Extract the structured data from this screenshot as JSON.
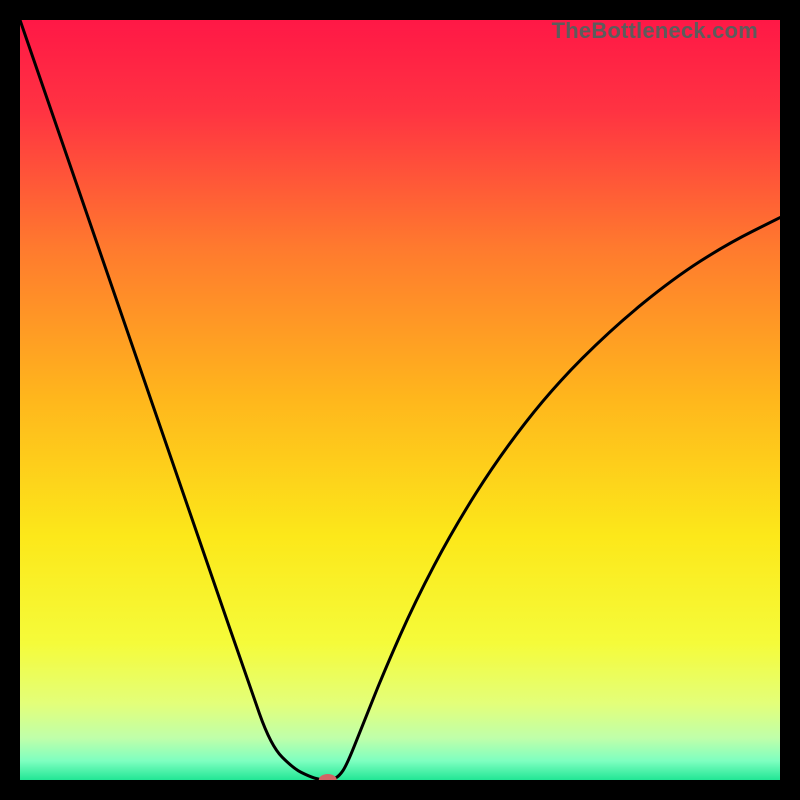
{
  "watermark": "TheBottleneck.com",
  "chart_data": {
    "type": "line",
    "title": "",
    "xlabel": "",
    "ylabel": "",
    "xlim": [
      0,
      100
    ],
    "ylim": [
      0,
      100
    ],
    "grid": false,
    "legend": false,
    "series": [
      {
        "name": "bottleneck-curve",
        "x": [
          0,
          5,
          10,
          15,
          20,
          25,
          30,
          33,
          36,
          38,
          39.5,
          41,
          42,
          43,
          45,
          48,
          52,
          57,
          63,
          70,
          78,
          86,
          93,
          100
        ],
        "y": [
          100,
          85.5,
          71,
          56.5,
          42,
          27.5,
          13,
          4.5,
          1.5,
          0.5,
          0,
          0,
          0.5,
          2,
          7,
          14.5,
          23.5,
          33,
          42.5,
          51.5,
          59.5,
          66,
          70.5,
          74
        ]
      }
    ],
    "marker": {
      "x": 40.5,
      "y": 0.0,
      "color": "#d16565"
    },
    "background_gradient": {
      "stops": [
        {
          "pos": 0.0,
          "color": "#ff1846"
        },
        {
          "pos": 0.12,
          "color": "#ff3342"
        },
        {
          "pos": 0.3,
          "color": "#ff7a2e"
        },
        {
          "pos": 0.5,
          "color": "#ffb71c"
        },
        {
          "pos": 0.68,
          "color": "#fce81a"
        },
        {
          "pos": 0.82,
          "color": "#f5fb3a"
        },
        {
          "pos": 0.9,
          "color": "#e3ff7a"
        },
        {
          "pos": 0.945,
          "color": "#bfffaa"
        },
        {
          "pos": 0.975,
          "color": "#7effc0"
        },
        {
          "pos": 1.0,
          "color": "#22e695"
        }
      ]
    }
  }
}
